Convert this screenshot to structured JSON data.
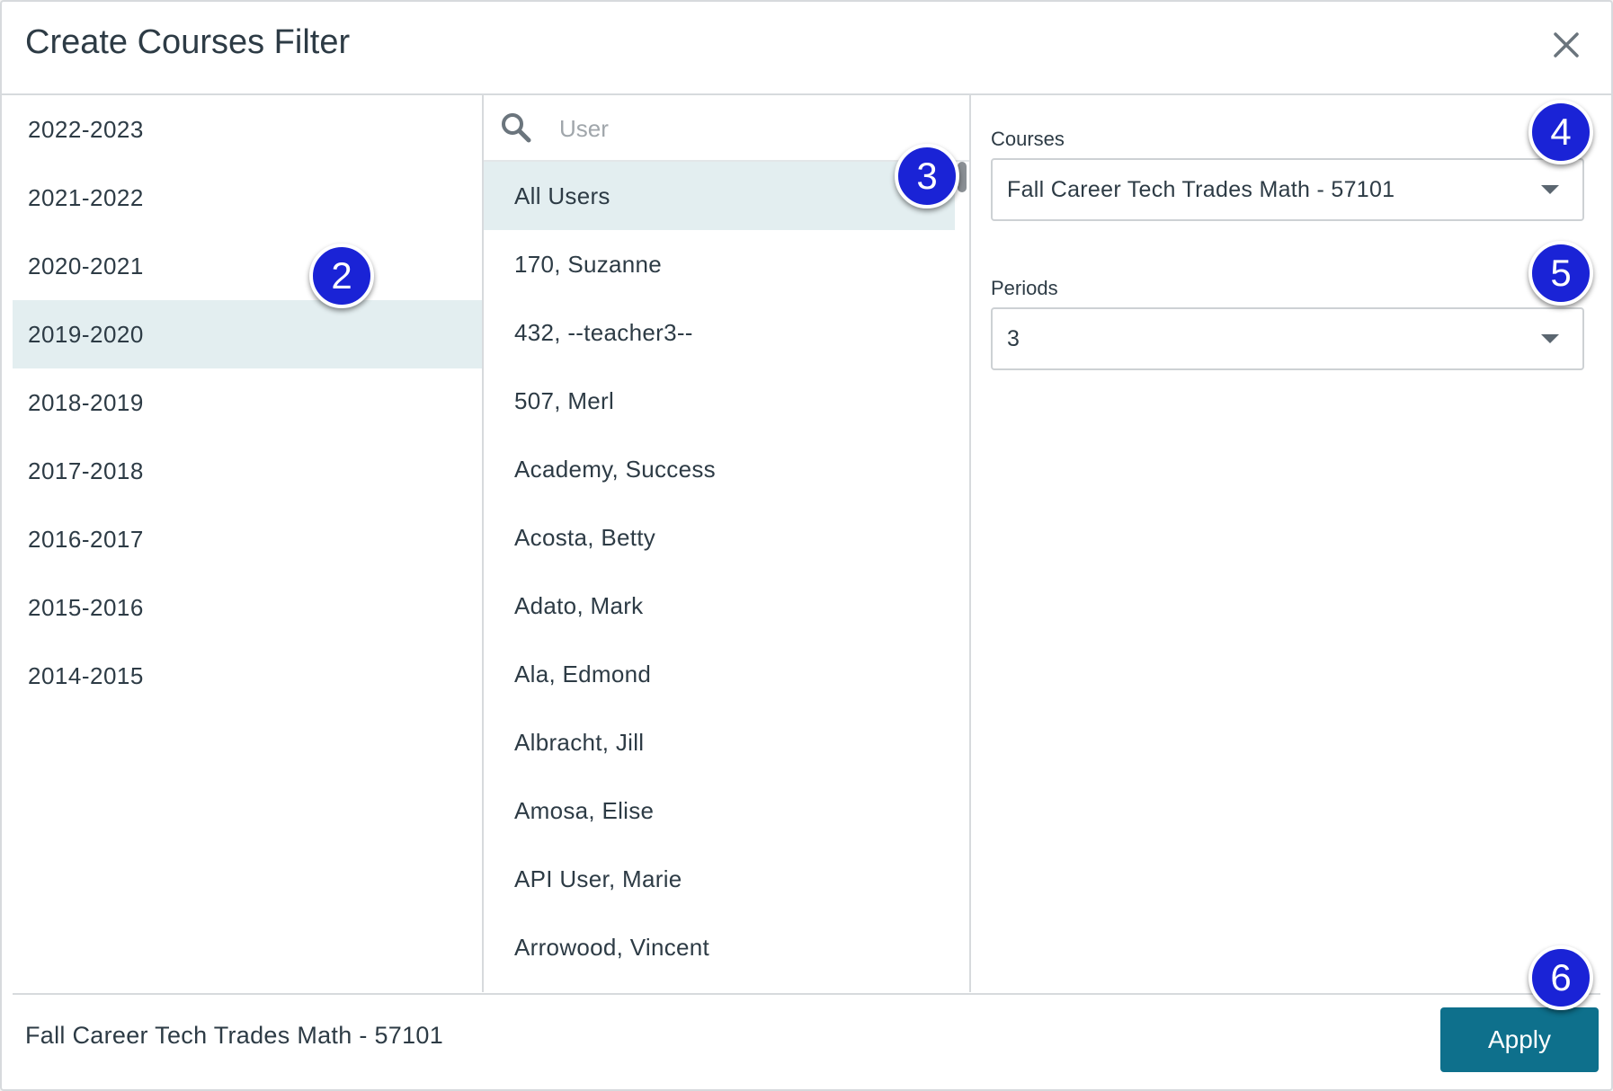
{
  "dialog": {
    "title": "Create Courses Filter"
  },
  "years": {
    "items": [
      "2022-2023",
      "2021-2022",
      "2020-2021",
      "2019-2020",
      "2018-2019",
      "2017-2018",
      "2016-2017",
      "2015-2016",
      "2014-2015"
    ],
    "selected": "2019-2020"
  },
  "users": {
    "search_placeholder": "User",
    "items": [
      "All Users",
      "170, Suzanne",
      "432, --teacher3--",
      "507, Merl",
      "Academy, Success",
      "Acosta, Betty",
      "Adato, Mark",
      "Ala, Edmond",
      "Albracht, Jill",
      "Amosa, Elise",
      "API User, Marie",
      "Arrowood, Vincent"
    ],
    "selected": "All Users"
  },
  "filters": {
    "courses_label": "Courses",
    "courses_value": "Fall Career Tech Trades Math - 57101",
    "periods_label": "Periods",
    "periods_value": "3"
  },
  "footer": {
    "summary": "Fall Career Tech Trades Math - 57101",
    "apply_label": "Apply"
  },
  "callouts": [
    "2",
    "3",
    "4",
    "5",
    "6"
  ],
  "colors": {
    "accent": "#0e708c",
    "selected_row": "#e3eef0",
    "callout": "#1a23d6"
  }
}
